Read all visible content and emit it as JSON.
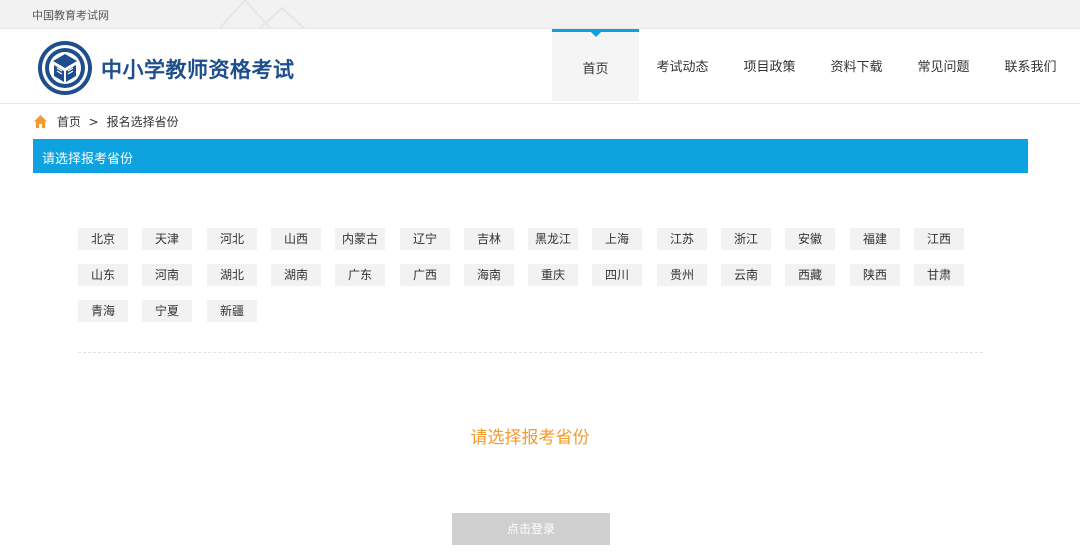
{
  "topbar": {
    "site_link": "中国教育考试网"
  },
  "header": {
    "site_title": "中小学教师资格考试"
  },
  "nav": {
    "items": [
      {
        "label": "首页",
        "active": true
      },
      {
        "label": "考试动态",
        "active": false
      },
      {
        "label": "项目政策",
        "active": false
      },
      {
        "label": "资料下载",
        "active": false
      },
      {
        "label": "常见问题",
        "active": false
      },
      {
        "label": "联系我们",
        "active": false
      }
    ]
  },
  "breadcrumb": {
    "home": "首页",
    "separator": ">",
    "current": "报名选择省份"
  },
  "section": {
    "title": "请选择报考省份"
  },
  "provinces": [
    "北京",
    "天津",
    "河北",
    "山西",
    "内蒙古",
    "辽宁",
    "吉林",
    "黑龙江",
    "上海",
    "江苏",
    "浙江",
    "安徽",
    "福建",
    "江西",
    "山东",
    "河南",
    "湖北",
    "湖南",
    "广东",
    "广西",
    "海南",
    "重庆",
    "四川",
    "贵州",
    "云南",
    "西藏",
    "陕西",
    "甘肃",
    "青海",
    "宁夏",
    "新疆"
  ],
  "prompt": "请选择报考省份",
  "login_button": "点击登录",
  "colors": {
    "accent": "#0ea2e0",
    "prompt": "#f39a2d",
    "title": "#1e4f8c",
    "disabled_button": "#cfcfcf"
  },
  "icons": {
    "logo": "teacher-exam-emblem",
    "home": "home-icon"
  }
}
